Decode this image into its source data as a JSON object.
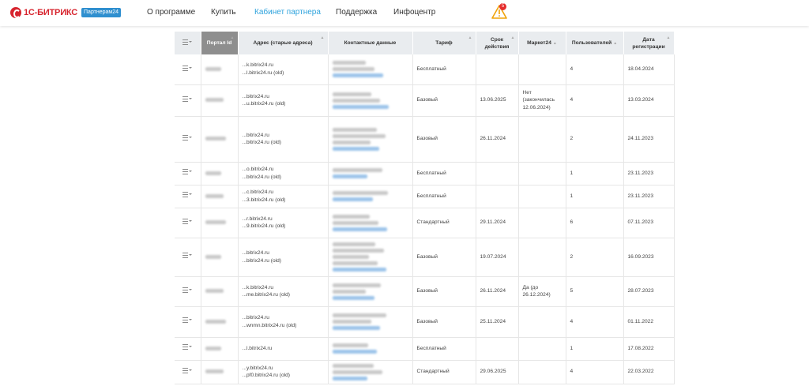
{
  "brand": {
    "logo_text": "1С-БИТРИКС",
    "badge": "Партнерам24"
  },
  "nav": {
    "items": [
      {
        "label": "О программе",
        "active": false
      },
      {
        "label": "Купить",
        "active": false
      },
      {
        "label": "Кабинет партнера",
        "active": true
      },
      {
        "label": "Поддержка",
        "active": false
      },
      {
        "label": "Инфоцентр",
        "active": false
      }
    ],
    "alert_count": "5",
    "accent_color": "#2fa3dd",
    "alert_color": "#f0a30a"
  },
  "table": {
    "headers": {
      "menu": "≡",
      "id": "Портал Id",
      "address": "Адрес (старые адреса)",
      "contacts": "Контактные данные",
      "tariff": "Тариф",
      "term": "Срок действия",
      "market": "Маркет24",
      "users": "Пользователей",
      "registered": "Дата регистрации"
    },
    "rows": [
      {
        "addr1": "...k.bitrix24.ru",
        "addr2": "...l.bitrix24.ru (old)",
        "tariff": "Бесплатный",
        "term": "",
        "market": "",
        "users": "4",
        "registered": "18.04.2024"
      },
      {
        "addr1": "...bitrix24.ru",
        "addr2": "...u.bitrix24.ru (old)",
        "tariff": "Базовый",
        "term": "13.06.2025",
        "market": "Нет (закончилась 12.06.2024)",
        "users": "4",
        "registered": "13.03.2024"
      },
      {
        "addr1": "...bitrix24.ru",
        "addr2": "...bitrix24.ru (old)",
        "tariff": "Базовый",
        "term": "26.11.2024",
        "market": "",
        "users": "2",
        "registered": "24.11.2023"
      },
      {
        "addr1": "...o.bitrix24.ru",
        "addr2": "...bitrix24.ru (old)",
        "tariff": "Бесплатный",
        "term": "",
        "market": "",
        "users": "1",
        "registered": "23.11.2023"
      },
      {
        "addr1": "...c.bitrix24.ru",
        "addr2": "...3.bitrix24.ru (old)",
        "tariff": "Бесплатный",
        "term": "",
        "market": "",
        "users": "1",
        "registered": "23.11.2023"
      },
      {
        "addr1": "...r.bitrix24.ru",
        "addr2": "...9.bitrix24.ru (old)",
        "tariff": "Стандартный",
        "term": "29.11.2024",
        "market": "",
        "users": "6",
        "registered": "07.11.2023"
      },
      {
        "addr1": "...bitrix24.ru",
        "addr2": "...bitrix24.ru (old)",
        "tariff": "Базовый",
        "term": "19.07.2024",
        "market": "",
        "users": "2",
        "registered": "16.09.2023"
      },
      {
        "addr1": "...k.bitrix24.ru",
        "addr2": "...me.bitrix24.ru (old)",
        "tariff": "Базовый",
        "term": "26.11.2024",
        "market": "Да (до 26.12.2024)",
        "users": "5",
        "registered": "28.07.2023"
      },
      {
        "addr1": "...bitrix24.ru",
        "addr2": "...wnmn.bitrix24.ru (old)",
        "tariff": "Базовый",
        "term": "25.11.2024",
        "market": "",
        "users": "4",
        "registered": "01.11.2022"
      },
      {
        "addr1": "...l.bitrix24.ru",
        "addr2": "",
        "tariff": "Бесплатный",
        "term": "",
        "market": "",
        "users": "1",
        "registered": "17.08.2022"
      },
      {
        "addr1": "...y.bitrix24.ru",
        "addr2": "...pf0.bitrix24.ru (old)",
        "tariff": "Стандартный",
        "term": "29.06.2025",
        "market": "",
        "users": "4",
        "registered": "22.03.2022"
      }
    ]
  }
}
